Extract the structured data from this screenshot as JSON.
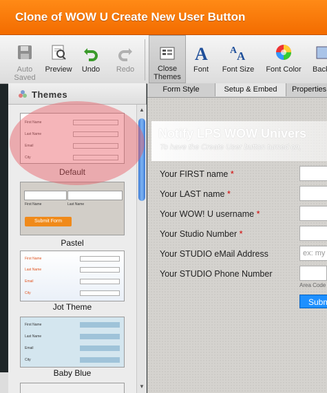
{
  "window": {
    "title": "Clone of WOW U Create New User Button"
  },
  "toolbar": {
    "auto_saved": "Auto\nSaved",
    "preview": "Preview",
    "undo": "Undo",
    "redo": "Redo",
    "close_themes": "Close\nThemes",
    "font": "Font",
    "font_size": "Font Size",
    "font_color": "Font Color",
    "back": "Back"
  },
  "subtabs": [
    "Form Style",
    "Setup & Embed",
    "Properties"
  ],
  "sidebar": {
    "heading": "Themes",
    "themes": [
      {
        "name": "Default",
        "fields": [
          "First Name",
          "Last Name",
          "Email",
          "City"
        ]
      },
      {
        "name": "Pastel",
        "fields": [
          "First Name",
          "Last Name"
        ],
        "button": "Submit Form"
      },
      {
        "name": "Jot Theme",
        "fields": [
          "First Name",
          "Last Name",
          "Email",
          "City"
        ]
      },
      {
        "name": "Baby Blue",
        "fields": [
          "First Name",
          "Last Name",
          "Email",
          "City"
        ]
      }
    ]
  },
  "form": {
    "title": "Notify LPS WOW Univers",
    "subtitle": "To have the Create User button turned on,",
    "fields": [
      {
        "label": "Your FIRST name",
        "required": "*",
        "placeholder": ""
      },
      {
        "label": "Your LAST name",
        "required": "*",
        "placeholder": ""
      },
      {
        "label": "Your WOW! U username",
        "required": "*",
        "placeholder": ""
      },
      {
        "label": "Your Studio Number",
        "required": "*",
        "placeholder": ""
      },
      {
        "label": "Your STUDIO eMail Address",
        "required": "",
        "placeholder": "ex: my"
      },
      {
        "label": "Your STUDIO Phone Number",
        "required": "",
        "placeholder": ""
      }
    ],
    "area_code_hint": "Area Code",
    "submit": "Subm"
  },
  "colors": {
    "titlebar": "#f36c00",
    "submit": "#1e90ff",
    "required": "#d40000",
    "highlight": "#e85a64"
  }
}
